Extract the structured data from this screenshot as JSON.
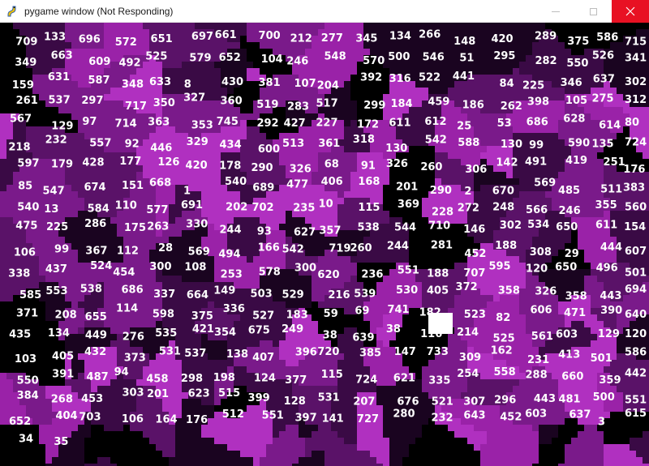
{
  "window": {
    "title": "pygame window (Not Responding)",
    "icon": "pygame-snake-icon",
    "controls": [
      "minimize-icon",
      "maximize-icon",
      "close-icon"
    ],
    "close_color": "#e81123"
  },
  "scene": {
    "description_colors": [
      "#000000",
      "#1a0420",
      "#3a0a45",
      "#5a1268",
      "#7a1a8a",
      "#9a22a8",
      "#b030c0"
    ],
    "label_color": "#ffffff",
    "labels": [
      "709",
      "133",
      "696",
      "572",
      "651",
      "697",
      "661",
      "700",
      "212",
      "277",
      "345",
      "134",
      "266",
      "148",
      "420",
      "289",
      "375",
      "586",
      "715",
      "349",
      "663",
      "609",
      "492",
      "525",
      "579",
      "652",
      "104",
      "246",
      "548",
      "570",
      "500",
      "546",
      "51",
      "295",
      "282",
      "550",
      "526",
      "341",
      "159",
      "631",
      "587",
      "348",
      "633",
      "8",
      "430",
      "381",
      "107",
      "204",
      "392",
      "316",
      "522",
      "441",
      "84",
      "225",
      "346",
      "637",
      "302",
      "261",
      "537",
      "297",
      "717",
      "350",
      "327",
      "360",
      "519",
      "283",
      "517",
      "299",
      "184",
      "459",
      "186",
      "262",
      "398",
      "105",
      "275",
      "312",
      "567",
      "129",
      "97",
      "714",
      "363",
      "353",
      "745",
      "292",
      "427",
      "227",
      "172",
      "611",
      "612",
      "25",
      "53",
      "686",
      "628",
      "614",
      "80",
      "218",
      "232",
      "557",
      "92",
      "446",
      "329",
      "434",
      "600",
      "513",
      "361",
      "318",
      "130",
      "542",
      "588",
      "130",
      "99",
      "590",
      "135",
      "724",
      "597",
      "179",
      "428",
      "177",
      "126",
      "420",
      "178",
      "290",
      "326",
      "68",
      "91",
      "326",
      "260",
      "306",
      "142",
      "491",
      "419",
      "251",
      "176",
      "85",
      "547",
      "674",
      "151",
      "668",
      "1",
      "540",
      "689",
      "477",
      "406",
      "168",
      "201",
      "290",
      "2",
      "670",
      "569",
      "485",
      "511",
      "383",
      "540",
      "13",
      "584",
      "110",
      "577",
      "691",
      "202",
      "702",
      "235",
      "10",
      "115",
      "369",
      "228",
      "272",
      "248",
      "566",
      "246",
      "355",
      "560",
      "475",
      "225",
      "286",
      "175",
      "263",
      "330",
      "244",
      "93",
      "627",
      "357",
      "538",
      "544",
      "710",
      "146",
      "302",
      "534",
      "650",
      "611",
      "154",
      "106",
      "99",
      "367",
      "112",
      "28",
      "569",
      "494",
      "166",
      "542",
      "719",
      "260",
      "244",
      "281",
      "452",
      "188",
      "308",
      "29",
      "444",
      "607",
      "338",
      "437",
      "524",
      "454",
      "300",
      "108",
      "253",
      "578",
      "300",
      "620",
      "236",
      "551",
      "188",
      "707",
      "595",
      "120",
      "650",
      "496",
      "501",
      "585",
      "553",
      "538",
      "686",
      "337",
      "664",
      "149",
      "503",
      "529",
      "216",
      "539",
      "530",
      "405",
      "372",
      "358",
      "326",
      "358",
      "443",
      "694",
      "371",
      "208",
      "655",
      "114",
      "598",
      "375",
      "336",
      "527",
      "183",
      "59",
      "69",
      "741",
      "182",
      "523",
      "82",
      "606",
      "471",
      "390",
      "640",
      "435",
      "134",
      "449",
      "276",
      "535",
      "421",
      "354",
      "675",
      "249",
      "38",
      "639",
      "38",
      "116",
      "214",
      "525",
      "561",
      "603",
      "129",
      "120",
      "103",
      "405",
      "432",
      "373",
      "531",
      "537",
      "138",
      "407",
      "396",
      "720",
      "385",
      "147",
      "733",
      "309",
      "162",
      "231",
      "413",
      "501",
      "586",
      "550",
      "391",
      "487",
      "94",
      "458",
      "298",
      "198",
      "124",
      "377",
      "115",
      "724",
      "621",
      "335",
      "254",
      "558",
      "288",
      "660",
      "359",
      "442",
      "384",
      "268",
      "453",
      "303",
      "201",
      "623",
      "515",
      "399",
      "128",
      "531",
      "207",
      "676",
      "521",
      "307",
      "296",
      "443",
      "481",
      "500",
      "551",
      "652",
      "404",
      "703",
      "106",
      "164",
      "176",
      "512",
      "551",
      "397",
      "141",
      "727",
      "280",
      "232",
      "643",
      "452",
      "603",
      "637",
      "3",
      "615",
      "34",
      "35"
    ]
  }
}
